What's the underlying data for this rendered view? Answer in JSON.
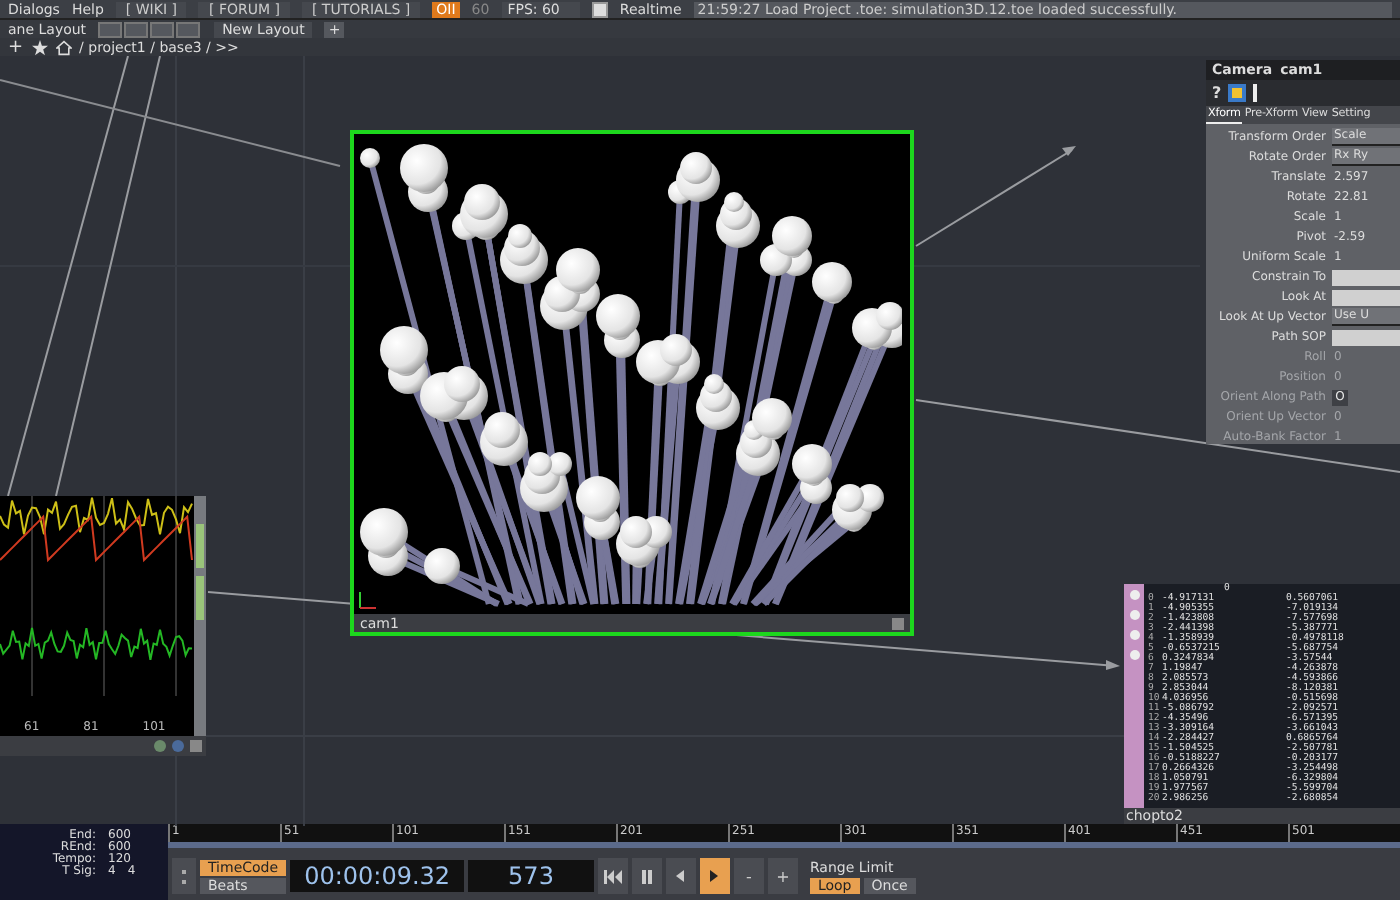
{
  "menu_bar": {
    "items": [
      "Dialogs",
      "Help"
    ],
    "links": [
      "[ WIKI ]",
      "[ FORUM ]",
      "[ TUTORIALS ]"
    ],
    "badge": "OII",
    "fps_limit": "60",
    "fps": "FPS: 60",
    "realtime": {
      "label": "Realtime",
      "checked": true
    },
    "message": "21:59:27 Load Project .toe: simulation3D.12.toe loaded successfully."
  },
  "layout_bar": {
    "pane_layout": "ane Layout",
    "new_layout": "New Layout",
    "add": "+"
  },
  "path_bar": {
    "add": "+",
    "path": "/ project1 / base3 / >>"
  },
  "viewer": {
    "label": "cam1",
    "selected": true
  },
  "parameters": {
    "type": "Camera",
    "name": "cam1",
    "help": "?",
    "tabs": [
      {
        "label": "Xform",
        "selected": true
      },
      {
        "label": "Pre-Xform",
        "selected": false
      },
      {
        "label": "View",
        "selected": false
      },
      {
        "label": "Setting",
        "selected": false
      }
    ],
    "params": [
      {
        "label": "Transform Order",
        "value": "Scale",
        "kind": "menu",
        "disabled": false
      },
      {
        "label": "Rotate Order",
        "value": "Rx Ry",
        "kind": "menu",
        "disabled": false
      },
      {
        "label": "Translate",
        "value": "2.597",
        "kind": "field",
        "disabled": false
      },
      {
        "label": "Rotate",
        "value": "22.81",
        "kind": "field",
        "disabled": false
      },
      {
        "label": "Scale",
        "value": "1",
        "kind": "field",
        "disabled": false
      },
      {
        "label": "Pivot",
        "value": "-2.59",
        "kind": "field",
        "disabled": false
      },
      {
        "label": "Uniform Scale",
        "value": "1",
        "kind": "field",
        "disabled": false
      },
      {
        "label": "Constrain To",
        "kind": "empty",
        "disabled": false
      },
      {
        "label": "Look At",
        "kind": "empty",
        "disabled": false
      },
      {
        "label": "Look At Up Vector",
        "value": "Use U",
        "kind": "menu",
        "disabled": false
      },
      {
        "label": "Path SOP",
        "kind": "empty",
        "disabled": false
      },
      {
        "label": "Roll",
        "value": "0",
        "kind": "field",
        "disabled": true
      },
      {
        "label": "Position",
        "value": "0",
        "kind": "field",
        "disabled": true
      },
      {
        "label": "Orient Along Path",
        "value": "O",
        "kind": "toggle",
        "disabled": true
      },
      {
        "label": "Orient Up Vector",
        "value": "0",
        "kind": "field",
        "disabled": true
      },
      {
        "label": "Auto-Bank Factor",
        "value": "1",
        "kind": "field",
        "disabled": true
      }
    ]
  },
  "chart_node": {
    "axis_labels": [
      "61",
      "81",
      "101"
    ]
  },
  "table_node": {
    "name": "chopto2",
    "header": "0",
    "rows": [
      {
        "index": "0",
        "values": [
          "-4.917131",
          "0.5607061"
        ]
      },
      {
        "index": "1",
        "values": [
          "-4.905355",
          "-7.019134"
        ]
      },
      {
        "index": "2",
        "values": [
          "-1.423808",
          "-7.577698"
        ]
      },
      {
        "index": "3",
        "values": [
          "-2.441398",
          "-5.387771"
        ]
      },
      {
        "index": "4",
        "values": [
          "-1.358939",
          "-0.4978118"
        ]
      },
      {
        "index": "5",
        "values": [
          "-0.6537215",
          "-5.687754"
        ]
      },
      {
        "index": "6",
        "values": [
          "0.3247834",
          "-3.57544"
        ]
      },
      {
        "index": "7",
        "values": [
          "1.19847",
          "-4.263878"
        ]
      },
      {
        "index": "8",
        "values": [
          "2.085573",
          "-4.593866"
        ]
      },
      {
        "index": "9",
        "values": [
          "2.853044",
          "-8.120381"
        ]
      },
      {
        "index": "10",
        "values": [
          "4.036956",
          "-0.515698"
        ]
      },
      {
        "index": "11",
        "values": [
          "-5.086792",
          "-2.092571"
        ]
      },
      {
        "index": "12",
        "values": [
          "-4.35496",
          "-6.571395"
        ]
      },
      {
        "index": "13",
        "values": [
          "-3.309164",
          "-3.661043"
        ]
      },
      {
        "index": "14",
        "values": [
          "-2.284427",
          "0.6865764"
        ]
      },
      {
        "index": "15",
        "values": [
          "-1.504525",
          "-2.507781"
        ]
      },
      {
        "index": "16",
        "values": [
          "-0.5188227",
          "-0.203177"
        ]
      },
      {
        "index": "17",
        "values": [
          "0.2664326",
          "-3.254498"
        ]
      },
      {
        "index": "18",
        "values": [
          "1.050791",
          "-6.329804"
        ]
      },
      {
        "index": "19",
        "values": [
          "1.977567",
          "-5.599704"
        ]
      },
      {
        "index": "20",
        "values": [
          "2.986256",
          "-2.680854"
        ]
      }
    ]
  },
  "timeline": {
    "info": [
      {
        "label": "End:",
        "values": [
          "600"
        ]
      },
      {
        "label": "REnd:",
        "values": [
          "600"
        ]
      },
      {
        "label": "Tempo:",
        "values": [
          "120"
        ]
      },
      {
        "label": "T Sig:",
        "values": [
          "4",
          "4"
        ]
      }
    ],
    "ruler": [
      "1",
      "51",
      "101",
      "151",
      "201",
      "251",
      "301",
      "351",
      "401",
      "451",
      "501"
    ],
    "modes": [
      {
        "label": "TimeCode",
        "selected": true
      },
      {
        "label": "Beats",
        "selected": false
      }
    ],
    "time": "00:00:09.32",
    "frame": "573",
    "transport": [
      {
        "kind": "rewind",
        "selected": false
      },
      {
        "kind": "pause",
        "selected": false
      },
      {
        "kind": "step_back",
        "selected": false
      },
      {
        "kind": "play",
        "selected": true
      },
      {
        "kind": "minus",
        "label": "-",
        "selected": false
      },
      {
        "kind": "plus",
        "label": "+",
        "selected": false
      }
    ],
    "range_limit": "Range Limit",
    "range_modes": [
      {
        "label": "Loop",
        "selected": true
      },
      {
        "label": "Once",
        "selected": false
      }
    ]
  }
}
